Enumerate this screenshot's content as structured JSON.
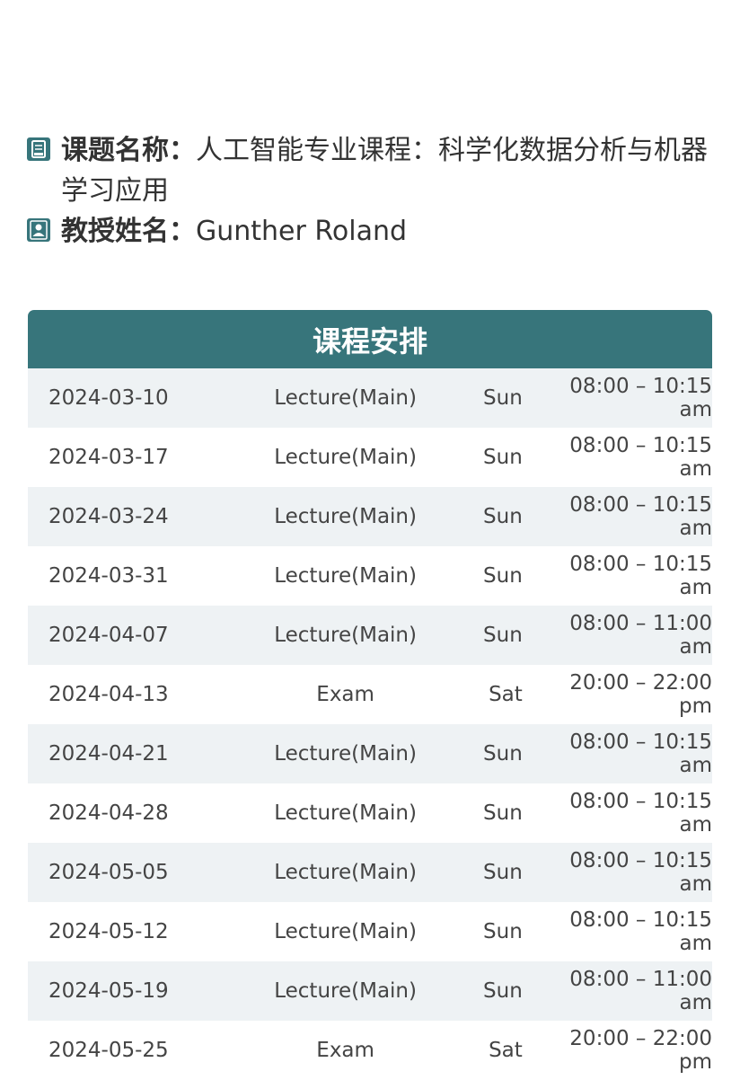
{
  "course": {
    "title_label": "课题名称：",
    "title_value": "人工智能专业课程：科学化数据分析与机器学习应用",
    "title_icon": "book-icon",
    "professor_label": "教授姓名：",
    "professor_value": "Gunther Roland",
    "professor_icon": "person-icon"
  },
  "schedule": {
    "header": "课程安排",
    "header_color": "#37757b",
    "rows": [
      {
        "date": "2024-03-10",
        "type": "Lecture(Main)",
        "day": "Sun",
        "time": "08:00 – 10:15 am"
      },
      {
        "date": "2024-03-17",
        "type": "Lecture(Main)",
        "day": "Sun",
        "time": "08:00 – 10:15 am"
      },
      {
        "date": "2024-03-24",
        "type": "Lecture(Main)",
        "day": "Sun",
        "time": "08:00 – 10:15 am"
      },
      {
        "date": "2024-03-31",
        "type": "Lecture(Main)",
        "day": "Sun",
        "time": "08:00 – 10:15 am"
      },
      {
        "date": "2024-04-07",
        "type": "Lecture(Main)",
        "day": "Sun",
        "time": "08:00 – 11:00 am"
      },
      {
        "date": "2024-04-13",
        "type": "Exam",
        "day": "Sat",
        "time": "20:00 – 22:00 pm"
      },
      {
        "date": "2024-04-21",
        "type": "Lecture(Main)",
        "day": "Sun",
        "time": "08:00 – 10:15 am"
      },
      {
        "date": "2024-04-28",
        "type": "Lecture(Main)",
        "day": "Sun",
        "time": "08:00 – 10:15 am"
      },
      {
        "date": "2024-05-05",
        "type": "Lecture(Main)",
        "day": "Sun",
        "time": "08:00 – 10:15 am"
      },
      {
        "date": "2024-05-12",
        "type": "Lecture(Main)",
        "day": "Sun",
        "time": "08:00 – 10:15 am"
      },
      {
        "date": "2024-05-19",
        "type": "Lecture(Main)",
        "day": "Sun",
        "time": "08:00 – 11:00 am"
      },
      {
        "date": "2024-05-25",
        "type": "Exam",
        "day": "Sat",
        "time": "20:00 – 22:00 pm"
      }
    ]
  }
}
